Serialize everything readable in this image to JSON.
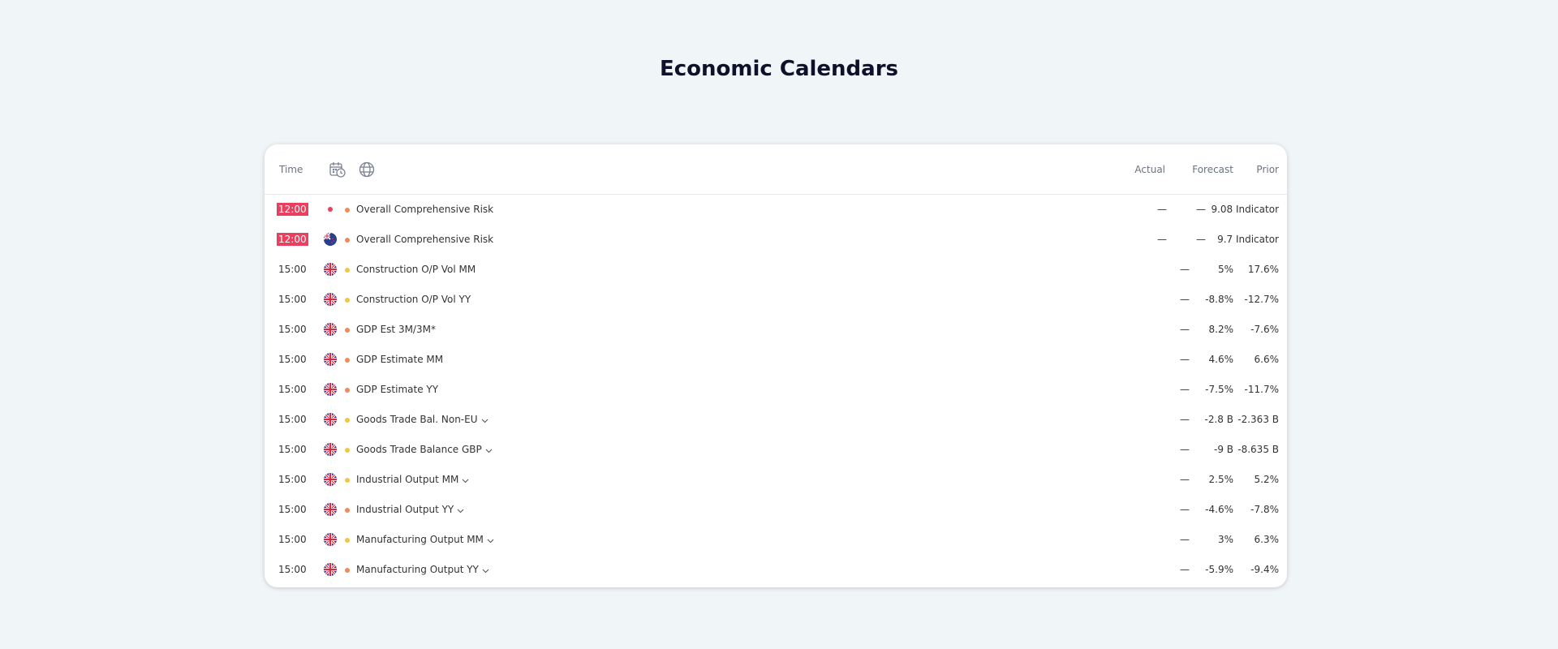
{
  "page": {
    "title": "Economic Calendars"
  },
  "columns": {
    "time": "Time",
    "actual": "Actual",
    "forecast": "Forecast",
    "prior": "Prior"
  },
  "colors": {
    "highlight": "#ea3f5e",
    "high_importance": "#ef8a5a",
    "medium_importance": "#f5c542"
  },
  "events": [
    {
      "time": "12:00",
      "highlight": true,
      "flag": "red-dot-icon",
      "importance": "high",
      "name": "Overall Comprehensive Risk",
      "dropdown": false,
      "actual": "—",
      "forecast": "—",
      "prior": "9.08 Indicator"
    },
    {
      "time": "12:00",
      "highlight": true,
      "flag": "new-zealand-flag-icon",
      "importance": "high",
      "name": "Overall Comprehensive Risk",
      "dropdown": false,
      "actual": "—",
      "forecast": "—",
      "prior": "9.7 Indicator"
    },
    {
      "time": "15:00",
      "highlight": false,
      "flag": "uk-flag-icon",
      "importance": "medium",
      "name": "Construction O/P Vol MM",
      "dropdown": false,
      "actual": "—",
      "forecast": "5%",
      "prior": "17.6%"
    },
    {
      "time": "15:00",
      "highlight": false,
      "flag": "uk-flag-icon",
      "importance": "medium",
      "name": "Construction O/P Vol YY",
      "dropdown": false,
      "actual": "—",
      "forecast": "-8.8%",
      "prior": "-12.7%"
    },
    {
      "time": "15:00",
      "highlight": false,
      "flag": "uk-flag-icon",
      "importance": "high",
      "name": "GDP Est 3M/3M*",
      "dropdown": false,
      "actual": "—",
      "forecast": "8.2%",
      "prior": "-7.6%"
    },
    {
      "time": "15:00",
      "highlight": false,
      "flag": "uk-flag-icon",
      "importance": "high",
      "name": "GDP Estimate MM",
      "dropdown": false,
      "actual": "—",
      "forecast": "4.6%",
      "prior": "6.6%"
    },
    {
      "time": "15:00",
      "highlight": false,
      "flag": "uk-flag-icon",
      "importance": "high",
      "name": "GDP Estimate YY",
      "dropdown": false,
      "actual": "—",
      "forecast": "-7.5%",
      "prior": "-11.7%"
    },
    {
      "time": "15:00",
      "highlight": false,
      "flag": "uk-flag-icon",
      "importance": "medium",
      "name": "Goods Trade Bal. Non-EU",
      "dropdown": true,
      "actual": "—",
      "forecast": "-2.8 B",
      "prior": "-2.363 B"
    },
    {
      "time": "15:00",
      "highlight": false,
      "flag": "uk-flag-icon",
      "importance": "medium",
      "name": "Goods Trade Balance GBP",
      "dropdown": true,
      "actual": "—",
      "forecast": "-9 B",
      "prior": "-8.635 B"
    },
    {
      "time": "15:00",
      "highlight": false,
      "flag": "uk-flag-icon",
      "importance": "medium",
      "name": "Industrial Output MM",
      "dropdown": true,
      "actual": "—",
      "forecast": "2.5%",
      "prior": "5.2%"
    },
    {
      "time": "15:00",
      "highlight": false,
      "flag": "uk-flag-icon",
      "importance": "high",
      "name": "Industrial Output YY",
      "dropdown": true,
      "actual": "—",
      "forecast": "-4.6%",
      "prior": "-7.8%"
    },
    {
      "time": "15:00",
      "highlight": false,
      "flag": "uk-flag-icon",
      "importance": "medium",
      "name": "Manufacturing Output MM",
      "dropdown": true,
      "actual": "—",
      "forecast": "3%",
      "prior": "6.3%"
    },
    {
      "time": "15:00",
      "highlight": false,
      "flag": "uk-flag-icon",
      "importance": "high",
      "name": "Manufacturing Output YY",
      "dropdown": true,
      "actual": "—",
      "forecast": "-5.9%",
      "prior": "-9.4%"
    }
  ]
}
